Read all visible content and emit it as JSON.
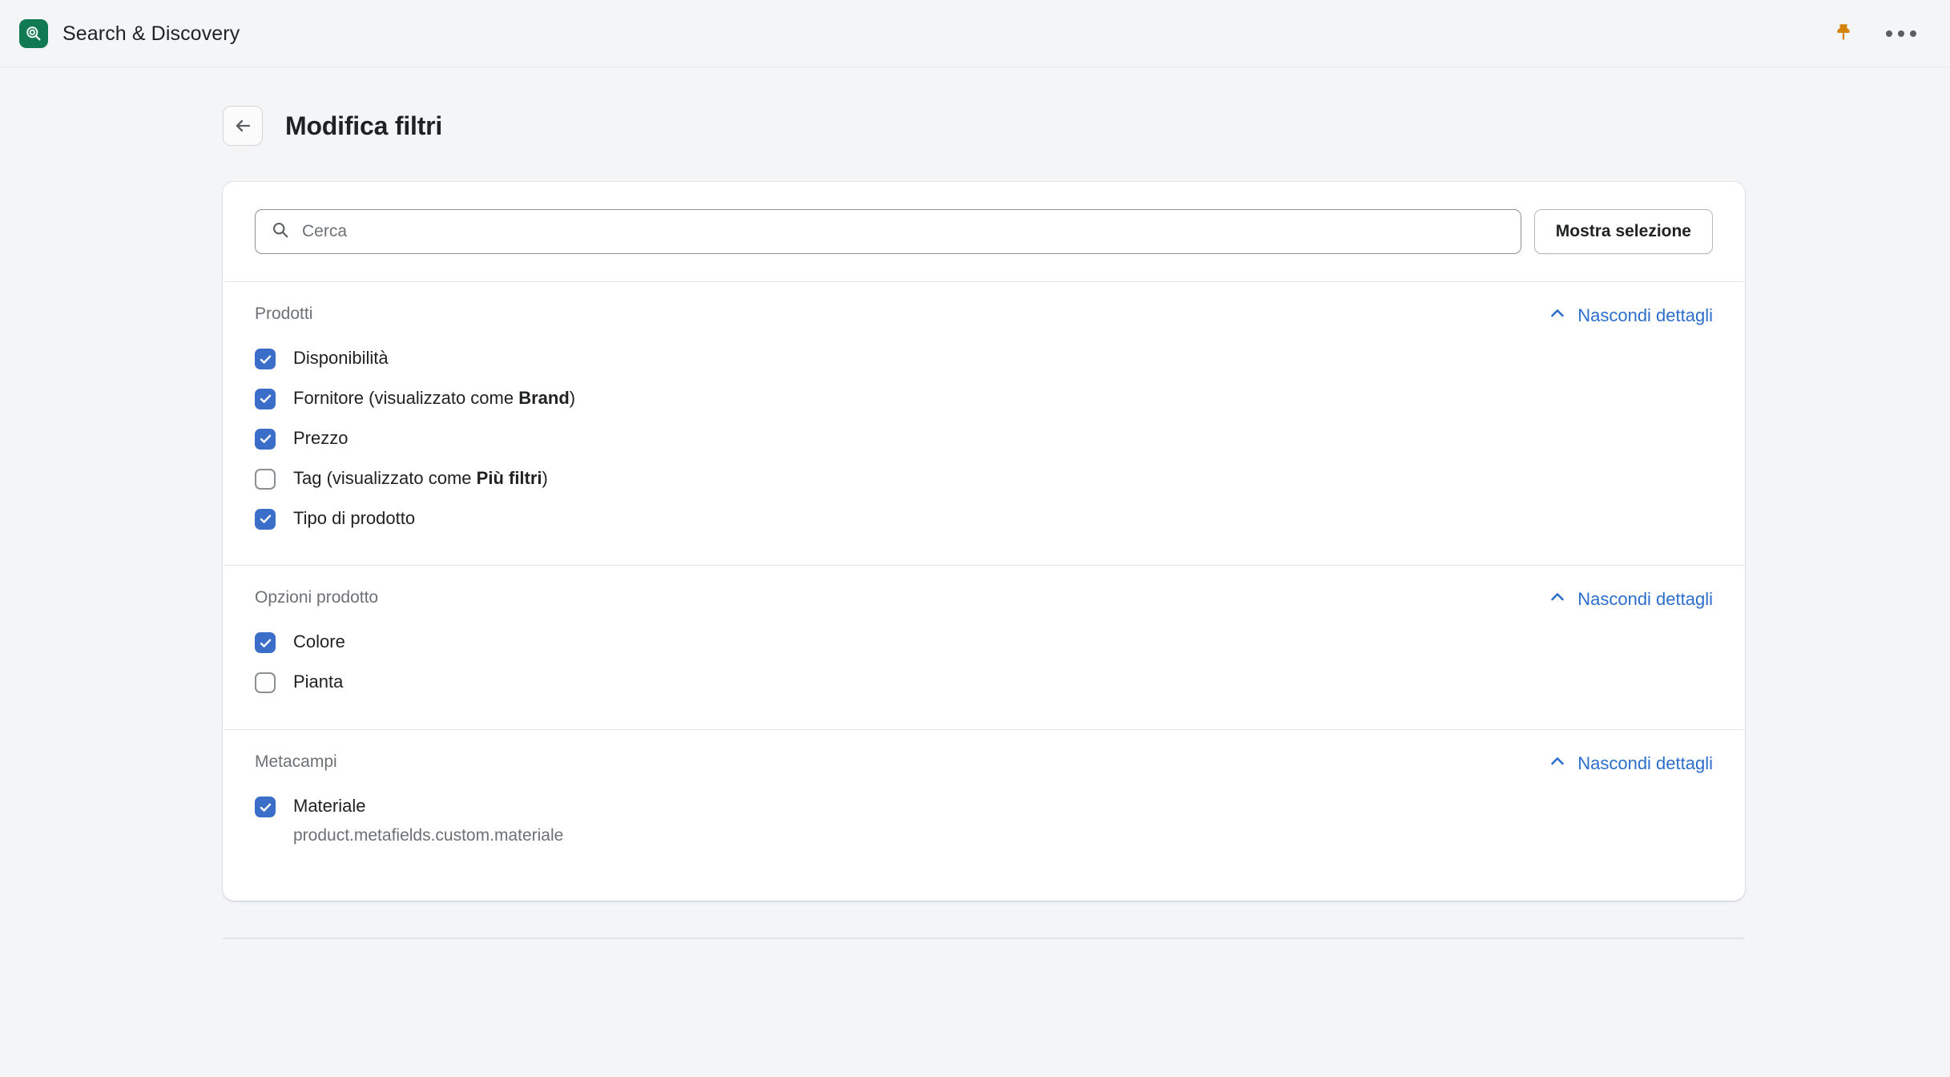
{
  "appbar": {
    "app_name": "Search & Discovery",
    "app_icon": "search-app-icon",
    "icon_color": "#117a52",
    "pin_icon": "pushpin-icon",
    "pin_color": "#d48408",
    "more_icon": "more-horizontal-icon"
  },
  "page": {
    "back_icon": "arrow-left-icon",
    "title": "Modifica filtri"
  },
  "search": {
    "icon": "search-icon",
    "value": "",
    "placeholder": "Cerca",
    "show_selection_label": "Mostra selezione"
  },
  "accent": {
    "link_blue": "#2c6ecb",
    "checkbox_blue": "#3b6ec9"
  },
  "sections": [
    {
      "title": "Prodotti",
      "toggle_label": "Nascondi dettagli",
      "toggle_icon": "chevron-up-icon",
      "items": [
        {
          "checked": true,
          "text": "Disponibilità",
          "bold": "",
          "suffix": ""
        },
        {
          "checked": true,
          "text": "Fornitore (visualizzato come ",
          "bold": "Brand",
          "suffix": ")"
        },
        {
          "checked": true,
          "text": "Prezzo",
          "bold": "",
          "suffix": ""
        },
        {
          "checked": false,
          "text": "Tag (visualizzato come ",
          "bold": "Più filtri",
          "suffix": ")"
        },
        {
          "checked": true,
          "text": "Tipo di prodotto",
          "bold": "",
          "suffix": ""
        }
      ]
    },
    {
      "title": "Opzioni prodotto",
      "toggle_label": "Nascondi dettagli",
      "toggle_icon": "chevron-up-icon",
      "items": [
        {
          "checked": true,
          "text": "Colore",
          "bold": "",
          "suffix": ""
        },
        {
          "checked": false,
          "text": "Pianta",
          "bold": "",
          "suffix": ""
        }
      ]
    },
    {
      "title": "Metacampi",
      "toggle_label": "Nascondi dettagli",
      "toggle_icon": "chevron-up-icon",
      "items": [
        {
          "checked": true,
          "text": "Materiale",
          "bold": "",
          "suffix": "",
          "sub": "product.metafields.custom.materiale"
        }
      ]
    }
  ]
}
